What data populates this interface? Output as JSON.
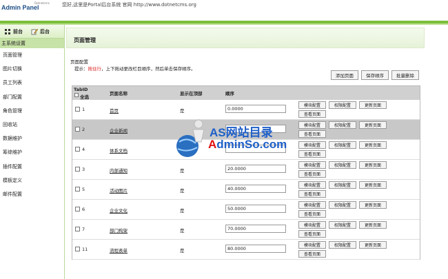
{
  "header": {
    "logo": "Admin Panel",
    "logo_sub": "Dotnetcms",
    "greeting": "您好,这里是Portal后台系统 官网 http://www.dotnetcms.org"
  },
  "sidebar": {
    "tab_front": "前台",
    "tab_back": "后台",
    "section": "主系统设置",
    "items": [
      "页面管理",
      "图片切换",
      "员工列表",
      "部门配置",
      "角色管理",
      "回收站",
      "数据维护",
      "筹综维护",
      "插件配置",
      "模板定义",
      "邮件配置"
    ]
  },
  "main": {
    "title": "页面管理",
    "panel_title": "页面配置",
    "hint_prefix": "提示：",
    "hint_red": "拖住行",
    "hint_suffix": "，上下拖动更改栏目顺序，然后单击保存顺序。",
    "btn_add": "添加页面",
    "btn_save_order": "保存顺序",
    "btn_batch_delete": "批量删除",
    "columns": {
      "tabid": "TabID",
      "select_all": "全选",
      "name": "页面名称",
      "show_top": "显示在顶部",
      "order": "顺序"
    },
    "row_buttons": {
      "module": "模块配置",
      "permission": "权限配置",
      "update": "更新页面",
      "view": "查看页面"
    },
    "rows": [
      {
        "id": "1",
        "name": "首页",
        "top": "是",
        "order": "0.0000"
      },
      {
        "id": "2",
        "name": "企业新闻",
        "top": "",
        "order": ""
      },
      {
        "id": "4",
        "name": "体系文档",
        "top": "",
        "order": ""
      },
      {
        "id": "3",
        "name": "内部通知",
        "top": "是",
        "order": "20.0000"
      },
      {
        "id": "5",
        "name": "活动图片",
        "top": "是",
        "order": "40.0000"
      },
      {
        "id": "6",
        "name": "企业文化",
        "top": "是",
        "order": "50.0000"
      },
      {
        "id": "7",
        "name": "部门构架",
        "top": "是",
        "order": "70.0000"
      },
      {
        "id": "11",
        "name": "流程表单",
        "top": "是",
        "order": "80.0000"
      }
    ]
  },
  "watermark": {
    "line1": "AS网站目录",
    "line2_a": "A",
    "line2_b": "dminSo.com"
  },
  "colors": {
    "accent_green": "#7cbf3a",
    "selected_row": "#c8c8c8",
    "hint_red": "#dd2222"
  }
}
